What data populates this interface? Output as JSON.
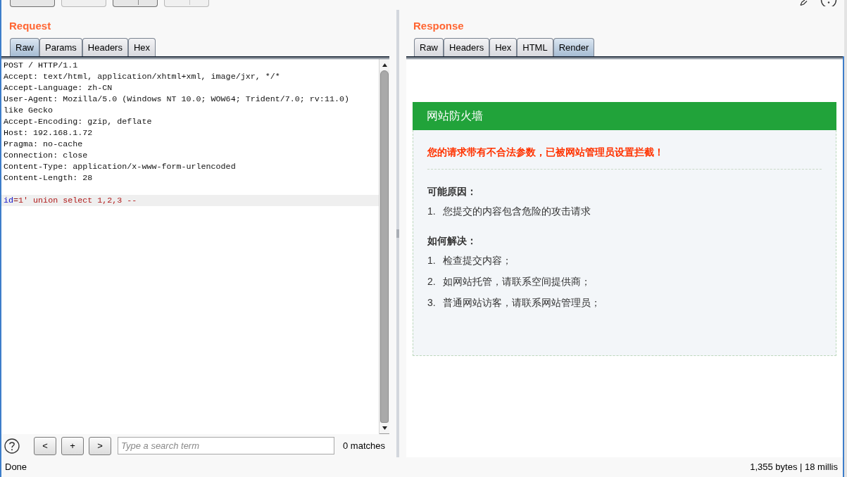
{
  "toolbar": {
    "buttons": [
      {
        "kind": "plain",
        "disabled": false
      },
      {
        "kind": "plain",
        "disabled": true
      },
      {
        "kind": "split",
        "disabled": false
      },
      {
        "kind": "split",
        "disabled": true
      }
    ]
  },
  "request": {
    "title": "Request",
    "tabs": [
      {
        "label": "Raw",
        "selected": true
      },
      {
        "label": "Params",
        "selected": false
      },
      {
        "label": "Headers",
        "selected": false
      },
      {
        "label": "Hex",
        "selected": false
      }
    ],
    "lines": [
      "POST / HTTP/1.1",
      "Accept: text/html, application/xhtml+xml, image/jxr, */*",
      "Accept-Language: zh-CN",
      "User-Agent: Mozilla/5.0 (Windows NT 10.0; WOW64; Trident/7.0; rv:11.0)",
      "like Gecko",
      "Accept-Encoding: gzip, deflate",
      "Host: 192.168.1.72",
      "Pragma: no-cache",
      "Connection: close",
      "Content-Type: application/x-www-form-urlencoded",
      "Content-Length: 28"
    ],
    "body": {
      "highlighted": true,
      "segments": [
        {
          "kind": "name",
          "text": "id"
        },
        {
          "kind": "operator",
          "text": "="
        },
        {
          "kind": "value",
          "text": "1' union select 1,2,3 --"
        }
      ]
    },
    "search": {
      "buttons": [
        "<",
        "+",
        ">"
      ],
      "placeholder": "Type a search term",
      "matches": "0 matches"
    }
  },
  "response": {
    "title": "Response",
    "tabs": [
      {
        "label": "Raw",
        "selected": false
      },
      {
        "label": "Headers",
        "selected": false
      },
      {
        "label": "Hex",
        "selected": false
      },
      {
        "label": "HTML",
        "selected": false
      },
      {
        "label": "Render",
        "selected": true
      }
    ],
    "render": {
      "header": "网站防火墙",
      "message": "您的请求带有不合法参数，已被网站管理员设置拦截！",
      "sections": [
        {
          "heading": "可能原因：",
          "items": [
            {
              "number": "1.",
              "text": "您提交的内容包含危险的攻击请求"
            }
          ]
        },
        {
          "heading": "如何解决：",
          "items": [
            {
              "number": "1.",
              "text": "检查提交内容；"
            },
            {
              "number": "2.",
              "text": "如网站托管，请联系空间提供商；"
            },
            {
              "number": "3.",
              "text": "普通网站访客，请联系网站管理员；"
            }
          ]
        }
      ]
    }
  },
  "status_bar": {
    "left": "Done",
    "right": "1,355 bytes | 18 millis"
  }
}
